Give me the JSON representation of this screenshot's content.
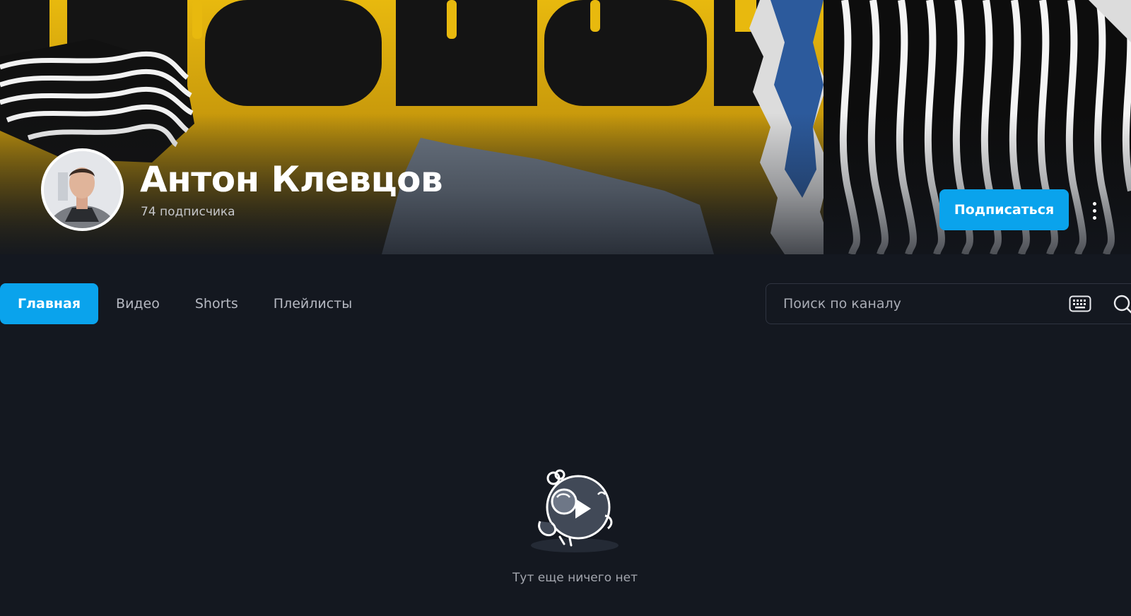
{
  "channel": {
    "name": "Антон Клевцов",
    "subscribers": "74 подписчика",
    "subscribe_label": "Подписаться"
  },
  "tabs": [
    {
      "label": "Главная",
      "active": true
    },
    {
      "label": "Видео",
      "active": false
    },
    {
      "label": "Shorts",
      "active": false
    },
    {
      "label": "Плейлисты",
      "active": false
    }
  ],
  "search": {
    "placeholder": "Поиск по каналу"
  },
  "empty_state": {
    "message": "Тут еще ничего нет"
  },
  "icons": {
    "more": "more-vertical-icon",
    "keyboard": "keyboard-icon",
    "search": "search-icon"
  },
  "colors": {
    "accent": "#0aa3ec",
    "background": "#141820",
    "banner_yellow": "#e8b90e"
  }
}
